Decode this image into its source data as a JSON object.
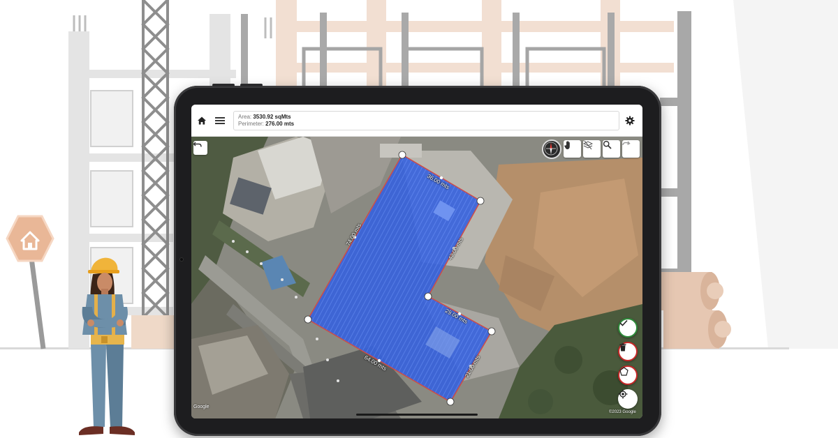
{
  "header": {
    "area_label": "Area:",
    "area_value": "3530.92 sqMts",
    "perimeter_label": "Perimeter:",
    "perimeter_value": "276.00 mts"
  },
  "icons": {
    "home": "home-icon",
    "menu": "menu-icon",
    "settings": "gear-icon",
    "undo": "undo-icon",
    "redo": "redo-icon",
    "compass": "compass-icon",
    "hand": "hand-icon",
    "layers": "layers-icon",
    "search": "search-icon",
    "confirm": "check-icon",
    "delete": "trash-icon",
    "polygon": "polygon-icon",
    "locate": "locate-icon",
    "house_sign": "house-icon"
  },
  "measurements": [
    {
      "label": "36.00 mts"
    },
    {
      "label": "42.00 mts"
    },
    {
      "label": "29.00 mts"
    },
    {
      "label": "21.00 mts"
    },
    {
      "label": "64.00 mts"
    },
    {
      "label": "74.00 mts"
    }
  ],
  "map": {
    "credit_left": "Google",
    "credit_right": "©2023 Google"
  },
  "colors": {
    "polygon_fill": "#2f6bff",
    "polygon_stroke": "#e0452f",
    "confirm": "#2e8b3a",
    "delete": "#c62828",
    "polygon_tool": "#c62828"
  }
}
